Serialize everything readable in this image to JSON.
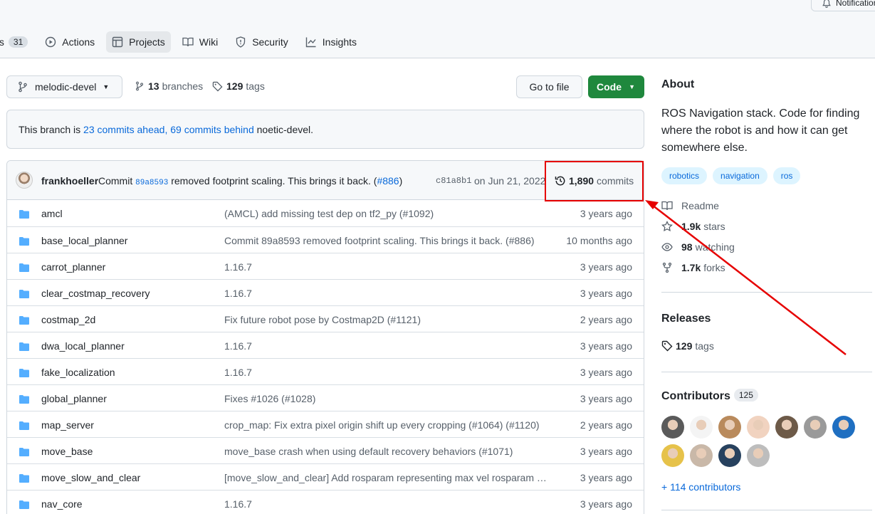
{
  "topbar": {
    "notifications_label": "Notifications"
  },
  "tabs": [
    {
      "label": "ts",
      "count": "31"
    },
    {
      "label": "Actions"
    },
    {
      "label": "Projects"
    },
    {
      "label": "Wiki"
    },
    {
      "label": "Security"
    },
    {
      "label": "Insights"
    }
  ],
  "branch": {
    "name": "melodic-devel",
    "branches_count": "13",
    "branches_label": "branches",
    "tags_count": "129",
    "tags_label": "tags",
    "go_to_file": "Go to file",
    "code": "Code"
  },
  "ahead_behind": {
    "prefix": "This branch is",
    "ahead": "23 commits ahead,",
    "behind": "69 commits behind",
    "base": "noetic-devel."
  },
  "latest_commit": {
    "author": "frankhoeller",
    "msg_prefix": "Commit",
    "msg_sha": "89a8593",
    "msg_rest": "removed footprint scaling. This brings it back. (",
    "msg_pr": "#886",
    "msg_end": ")",
    "sha": "c81a8b1",
    "date": "on Jun 21, 2022",
    "commit_count": "1,890",
    "commit_label": "commits"
  },
  "files": [
    {
      "name": "amcl",
      "msg": "(AMCL) add missing test dep on tf2_py (#1092)",
      "age": "3 years ago"
    },
    {
      "name": "base_local_planner",
      "msg": "Commit 89a8593 removed footprint scaling. This brings it back. (#886)",
      "age": "10 months ago"
    },
    {
      "name": "carrot_planner",
      "msg": "1.16.7",
      "age": "3 years ago"
    },
    {
      "name": "clear_costmap_recovery",
      "msg": "1.16.7",
      "age": "3 years ago"
    },
    {
      "name": "costmap_2d",
      "msg": "Fix future robot pose by Costmap2D (#1121)",
      "age": "2 years ago"
    },
    {
      "name": "dwa_local_planner",
      "msg": "1.16.7",
      "age": "3 years ago"
    },
    {
      "name": "fake_localization",
      "msg": "1.16.7",
      "age": "3 years ago"
    },
    {
      "name": "global_planner",
      "msg": "Fixes #1026 (#1028)",
      "age": "3 years ago"
    },
    {
      "name": "map_server",
      "msg": "crop_map: Fix extra pixel origin shift up every cropping (#1064) (#1120)",
      "age": "2 years ago"
    },
    {
      "name": "move_base",
      "msg": "move_base crash when using default recovery behaviors (#1071)",
      "age": "3 years ago"
    },
    {
      "name": "move_slow_and_clear",
      "msg": "[move_slow_and_clear] Add rosparam representing max vel rosparam na...",
      "age": "3 years ago"
    },
    {
      "name": "nav_core",
      "msg": "1.16.7",
      "age": "3 years ago"
    }
  ],
  "about": {
    "title": "About",
    "description": "ROS Navigation stack. Code for finding where the robot is and how it can get somewhere else.",
    "topics": [
      "robotics",
      "navigation",
      "ros"
    ],
    "readme": "Readme",
    "stars_count": "1.9k",
    "stars_label": "stars",
    "watching_count": "98",
    "watching_label": "watching",
    "forks_count": "1.7k",
    "forks_label": "forks"
  },
  "releases": {
    "title": "Releases",
    "tags_count": "129",
    "tags_label": "tags"
  },
  "contributors": {
    "title": "Contributors",
    "count": "125",
    "more": "+ 114 contributors",
    "avatar_colors": [
      "#5a5a5a",
      "#f4f4f4",
      "#b98a5c",
      "#f1d3c0",
      "#6d5a48",
      "#9a9a9a",
      "#1f6fc1",
      "#e6c24a",
      "#c9b8a8",
      "#27415e",
      "#bdbdbd"
    ]
  },
  "colors": {
    "accent": "#0969da",
    "code_button": "#1f883d",
    "annotation": "#e60000",
    "folder": "#54aeff"
  }
}
